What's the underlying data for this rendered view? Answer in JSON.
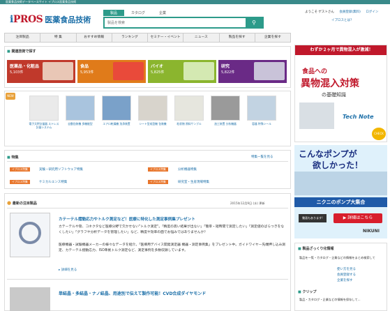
{
  "topbar": {
    "text": "医薬食品技術データベースサイト イプロス医薬食品技術"
  },
  "logo": {
    "brand_i": "i",
    "brand_rest": "PROS",
    "name": "医薬食品技術"
  },
  "search": {
    "tabs": [
      "製品",
      "カタログ",
      "企業"
    ],
    "placeholder": "製品を検索",
    "button_icon": "search-icon"
  },
  "header": {
    "guest": "ようこそ ゲストさん",
    "member": "会員登録(無料)",
    "login": "ログイン",
    "help": "イプロスとは？"
  },
  "nav": [
    "注目製品",
    "特 集",
    "おすすめ情報",
    "ランキング",
    "セミナー・イベント",
    "ニュース",
    "製品を探す",
    "企業を探す"
  ],
  "categories": {
    "title": "関連技術で探す",
    "items": [
      {
        "label": "医薬品・化粧品",
        "count": "5,103件",
        "color": "#c0392b",
        "img": "#e9c7b6"
      },
      {
        "label": "食品",
        "count": "5,953件",
        "color": "#e07b1a",
        "img": "#e94a3a"
      },
      {
        "label": "バイオ",
        "count": "5,825件",
        "color": "#8bb52e",
        "img": "#d4e9b2"
      },
      {
        "label": "研究",
        "count": "5,822件",
        "color": "#6a2a86",
        "img": "#c9c3d9"
      }
    ]
  },
  "products": {
    "badge": "NEW",
    "items": [
      {
        "label": "電子天秤計量器 ストレス計量システム",
        "img": "#eaeaea"
      },
      {
        "label": "自動包装機 多機能型",
        "img": "#a9c4de"
      },
      {
        "label": "エアロ乾燥機 洗浄装置",
        "img": "#7aa1c9"
      },
      {
        "label": "シート型成型機 包装機",
        "img": "#d8d4cc"
      },
      {
        "label": "粒状物 原料サンプル",
        "img": "#e6e6de"
      },
      {
        "label": "加工装置 分析機器",
        "img": "#9a9a9a"
      },
      {
        "label": "容器 特殊シール",
        "img": "#c2d3e2"
      }
    ]
  },
  "features": {
    "title": "特集",
    "more": "特集一覧を見る",
    "rows": [
      {
        "tag": "イプロス特集",
        "text": "実験・研究用ソフトウェア特集",
        "tag2": "イプロス特集",
        "text2": "分析機器特集"
      },
      {
        "tag": "イプロス特集",
        "text": "ケミカルエンス特集",
        "tag2": "イプロス特集",
        "text2": "研究室・生産現場特集"
      }
    ]
  },
  "news": {
    "title": "最新の注目製品",
    "date": "2015年12月9日 (水) 更新",
    "headline": "カテーテル摺動応力やトルク測定など！医療に特化した測定事例集プレゼント",
    "body1": "カテーテルや管、コネクタなど医療分野で欠かせない\"トルク測定\"。「精度の高い結果が出ない」「簡単・短時間で測定したい」「測定値のばらつきをなくしたい」「グラフや分析データを管理したい」など、精度や効率の面でお悩みではありませんか？",
    "body2": "医療機器・試験機器メーカーの様々なデータを紹介。「医療用デバイス開発測定器 機器・測定事例集」をプレゼント中。ガイドワイヤー先端押し込み測定、カテーテル摺動応力、ISO準拠トルク測定など、測定事例を多数収録しています。",
    "more": "詳細を見る",
    "headline2": "単結晶・多結晶・ナノ結晶、用途別で伝えて製作可能！CVD合成ダイヤモンド"
  },
  "ad1": {
    "top": "わずか２ヶ月で異物混入が激減！",
    "line1": "食品への",
    "line2": "異物混入対策",
    "line3": "の基礎知識",
    "brand": "Tech Note",
    "check": "CHECK"
  },
  "ad2": {
    "line1": "こんなポンプが",
    "line2": "欲しかった！",
    "line3": "ニクニのポンプ大集合",
    "video": "動画もあります!",
    "detail": "詳細はこちら",
    "maker": "NIKUNI"
  },
  "sidebox": {
    "title": "製品ざっくり化情報",
    "text": "製品を一覧・カタログ・企業などの情報をまとめ検索して",
    "links": [
      "使い方を見る",
      "会員登録する",
      "企業を探す"
    ],
    "clip": "クリップ",
    "clip_text": "製品・カタログ・企業などの情報を保存して..."
  }
}
